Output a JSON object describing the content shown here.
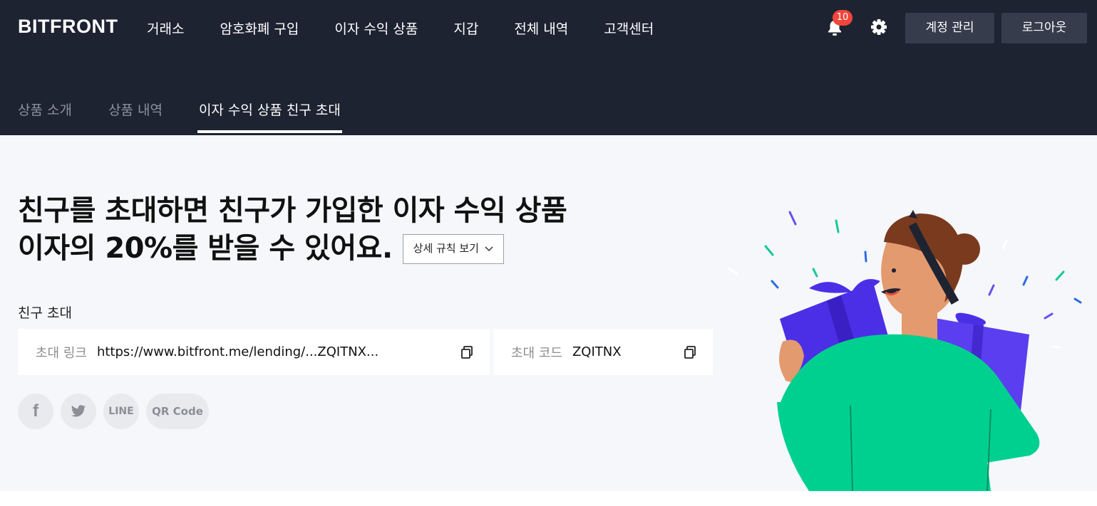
{
  "header": {
    "logo": "BITFRONT",
    "nav": [
      "거래소",
      "암호화폐 구입",
      "이자 수익 상품",
      "지갑",
      "전체 내역",
      "고객센터"
    ],
    "notification_count": "10",
    "account_button": "계정 관리",
    "logout_button": "로그아웃"
  },
  "subnav": {
    "tabs": [
      "상품 소개",
      "상품 내역",
      "이자 수익 상품 친구 초대"
    ],
    "active": "이자 수익 상품 친구 초대"
  },
  "main": {
    "headline_line1": "친구를 초대하면 친구가 가입한 이자 수익 상품",
    "headline_line2": "이자의 20%를 받을 수 있어요.",
    "rules_button": "상세 규칙 보기",
    "invite_title": "친구 초대",
    "invite_link_label": "초대 링크",
    "invite_link_value": "https://www.bitfront.me/lending/...ZQITNX...",
    "invite_code_label": "초대 코드",
    "invite_code_value": "ZQITNX",
    "share": {
      "facebook_label": "f",
      "line_label": "LINE",
      "qr_label": "QR Code"
    }
  },
  "colors": {
    "header_bg": "#1e2332",
    "content_bg": "#f5f7fa",
    "badge": "#f0463c",
    "gift_purple": "#4b2fe6",
    "shirt_green": "#00d08f"
  },
  "icons": [
    "bell-icon",
    "gear-icon",
    "copy-icon",
    "chevron-down-icon",
    "facebook-icon",
    "twitter-icon"
  ]
}
